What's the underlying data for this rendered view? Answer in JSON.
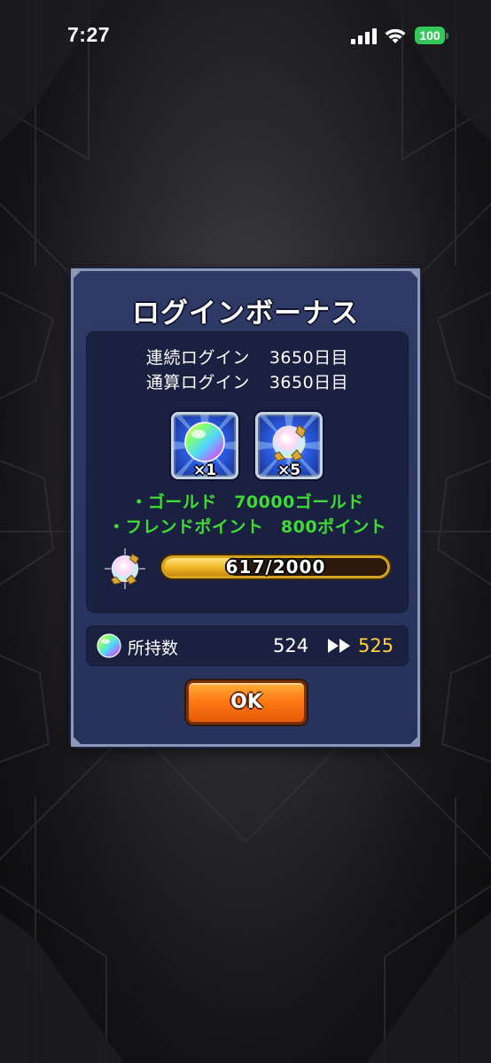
{
  "status_bar": {
    "time": "7:27",
    "battery_level": "100",
    "battery_color": "#34c759",
    "signal_icon": "cellular-signal-icon",
    "wifi_icon": "wifi-icon"
  },
  "dialog": {
    "title": "ログインボーナス",
    "login_stats": {
      "consecutive_label": "連続ログイン",
      "consecutive_value": "3650日目",
      "total_label": "通算ログイン",
      "total_value": "3650日目"
    },
    "rewards": [
      {
        "icon": "rainbow-orb-icon",
        "count": "×1"
      },
      {
        "icon": "crystal-fragment-icon",
        "count": "×5"
      }
    ],
    "bonuses": [
      {
        "text": "・ゴールド　70000ゴールド"
      },
      {
        "text": "・フレンドポイント　800ポイント"
      }
    ],
    "progress": {
      "icon": "crystal-fragment-icon",
      "text": "617/2000",
      "current": 617,
      "max": 2000
    },
    "owned": {
      "icon": "rainbow-orb-icon",
      "label": "所持数",
      "before": "524",
      "arrow_icon": "double-arrow-right-icon",
      "after": "525",
      "after_color": "#ffd23a"
    },
    "ok_label": "OK",
    "accent_green": "#3fdc36",
    "button_color": "#ff7a12"
  }
}
